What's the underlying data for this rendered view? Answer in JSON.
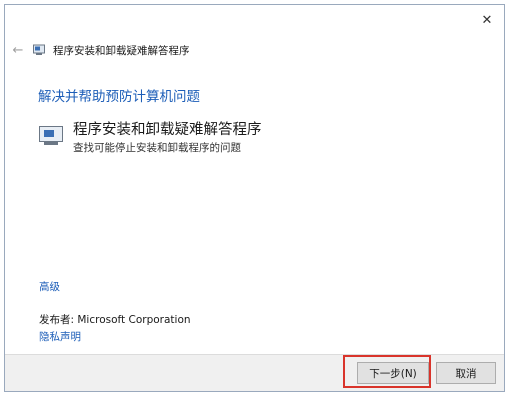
{
  "window": {
    "close_glyph": "✕",
    "back_glyph": "←",
    "title": "程序安装和卸载疑难解答程序"
  },
  "main": {
    "heading": "解决并帮助预防计算机问题",
    "option_title": "程序安装和卸载疑难解答程序",
    "option_description": "查找可能停止安装和卸载程序的问题"
  },
  "links": {
    "advanced": "高级",
    "publisher": "发布者: Microsoft Corporation",
    "privacy": "隐私声明"
  },
  "footer": {
    "next_label": "下一步(N)",
    "cancel_label": "取消"
  },
  "colors": {
    "link": "#1d5eb8",
    "highlight": "#d9342b"
  }
}
